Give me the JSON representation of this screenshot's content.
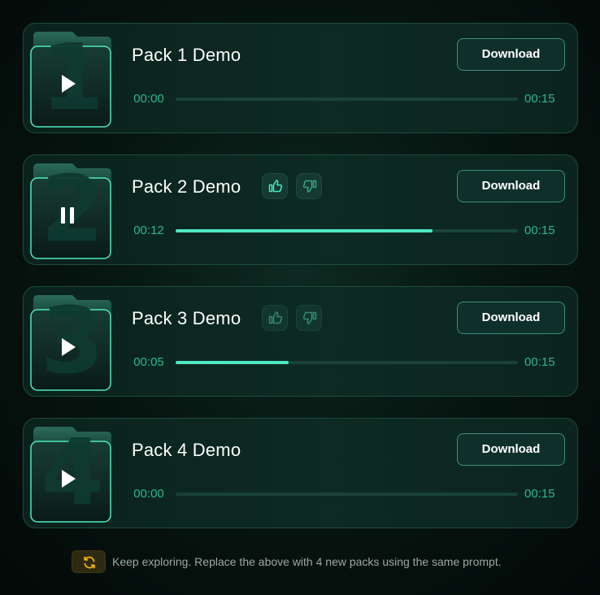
{
  "packs": [
    {
      "title": "Pack 1 Demo",
      "number": "1",
      "state": "paused",
      "current": "00:00",
      "duration": "00:15",
      "progress": 0.0,
      "download": "Download",
      "rating": false
    },
    {
      "title": "Pack 2 Demo",
      "number": "2",
      "state": "playing",
      "current": "00:12",
      "duration": "00:15",
      "progress": 0.75,
      "download": "Download",
      "rating": true,
      "rating_style": "active"
    },
    {
      "title": "Pack 3 Demo",
      "number": "3",
      "state": "paused",
      "current": "00:05",
      "duration": "00:15",
      "progress": 0.33,
      "download": "Download",
      "rating": true,
      "rating_style": "dim"
    },
    {
      "title": "Pack 4 Demo",
      "number": "4",
      "state": "paused",
      "current": "00:00",
      "duration": "00:15",
      "progress": 0.0,
      "download": "Download",
      "rating": false
    }
  ],
  "footer": {
    "text": "Keep exploring. Replace the above with 4 new packs using the same prompt.",
    "icon": "refresh-icon"
  },
  "colors": {
    "accent": "#4fe8c0",
    "time": "#2cb594",
    "refresh": "#f5b400"
  },
  "icons": {
    "play": "play-icon",
    "pause": "pause-icon",
    "like": "thumbs-up-icon",
    "dislike": "thumbs-down-icon"
  }
}
